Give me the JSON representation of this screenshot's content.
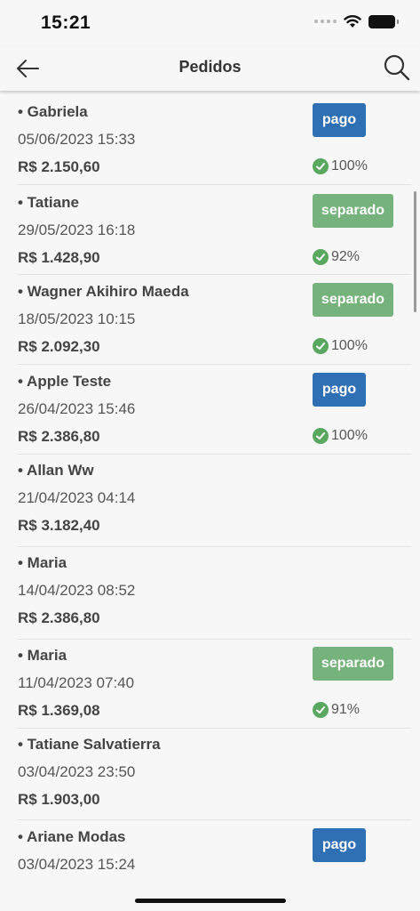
{
  "status_bar": {
    "time": "15:21"
  },
  "nav": {
    "title": "Pedidos"
  },
  "orders": [
    {
      "name": "• Gabriela",
      "date": "05/06/2023 15:33",
      "total": "R$ 2.150,60",
      "status": "pago",
      "progress": "100%"
    },
    {
      "name": "• Tatiane",
      "date": "29/05/2023 16:18",
      "total": "R$ 1.428,90",
      "status": "separado",
      "progress": "92%"
    },
    {
      "name": "• Wagner Akihiro Maeda",
      "date": "18/05/2023 10:15",
      "total": "R$ 2.092,30",
      "status": "separado",
      "progress": "100%"
    },
    {
      "name": "• Apple Teste",
      "date": "26/04/2023 15:46",
      "total": "R$ 2.386,80",
      "status": "pago",
      "progress": "100%"
    },
    {
      "name": "• Allan Ww",
      "date": "21/04/2023 04:14",
      "total": "R$ 3.182,40",
      "status": "",
      "progress": ""
    },
    {
      "name": "• Maria",
      "date": "14/04/2023 08:52",
      "total": "R$ 2.386,80",
      "status": "",
      "progress": ""
    },
    {
      "name": "• Maria",
      "date": "11/04/2023 07:40",
      "total": "R$ 1.369,08",
      "status": "separado",
      "progress": "91%"
    },
    {
      "name": "• Tatiane Salvatierra",
      "date": "03/04/2023 23:50",
      "total": "R$ 1.903,00",
      "status": "",
      "progress": ""
    },
    {
      "name": "• Ariane Modas",
      "date": "03/04/2023 15:24",
      "total": "",
      "status": "pago",
      "progress": ""
    }
  ],
  "colors": {
    "pago": "#2f6fb4",
    "separado": "#76b27b",
    "check": "#5aa75f"
  }
}
